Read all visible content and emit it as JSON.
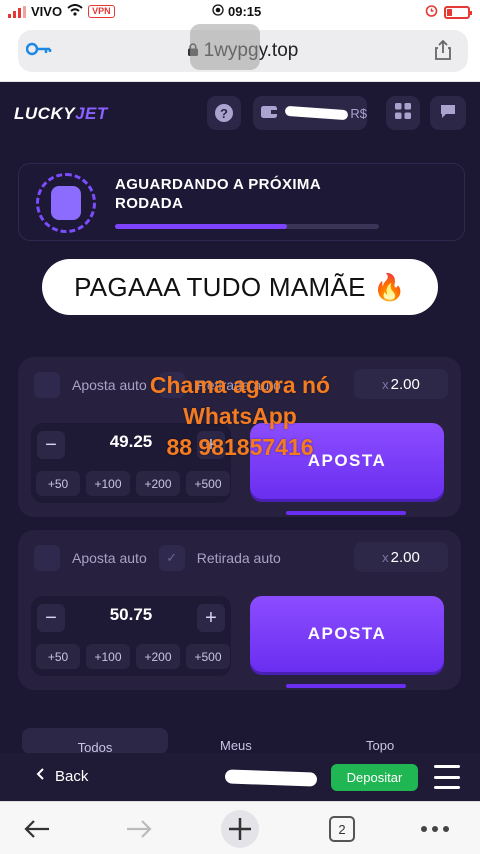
{
  "status_bar": {
    "carrier": "VIVO",
    "vpn": "VPN",
    "time": "09:15"
  },
  "url_bar": {
    "domain": "1wypgy.top"
  },
  "header": {
    "logo_lucky": "LUCKY",
    "logo_jet": "JET",
    "help": "?",
    "balance_suffix": "R$"
  },
  "waiting": {
    "title": "AGUARDANDO A PRÓXIMA RODADA",
    "progress": 0.65
  },
  "banner": {
    "text": "PAGAAA TUDO MAMÃE 🔥"
  },
  "overlay": {
    "line1": "Chama agora nó",
    "line2": "WhatsApp",
    "line3": "88 981857416"
  },
  "bets": [
    {
      "auto_bet_label": "Aposta auto",
      "auto_cashout_label": "Retirada auto",
      "multiplier_prefix": "x",
      "multiplier": "2.00",
      "amount": "49.25",
      "minus": "−",
      "plus": "+",
      "quick": [
        "+50",
        "+100",
        "+200",
        "+500"
      ],
      "button": "APOSTA"
    },
    {
      "auto_bet_label": "Aposta auto",
      "auto_cashout_label": "Retirada auto",
      "multiplier_prefix": "x",
      "multiplier": "2.00",
      "amount": "50.75",
      "minus": "−",
      "plus": "+",
      "quick": [
        "+50",
        "+100",
        "+200",
        "+500"
      ],
      "button": "APOSTA"
    }
  ],
  "tabs": [
    "Todos",
    "Meus",
    "Topo"
  ],
  "app_bar": {
    "back": "Back",
    "deposit": "Depositar"
  },
  "browser_bar": {
    "tab_count": "2"
  }
}
